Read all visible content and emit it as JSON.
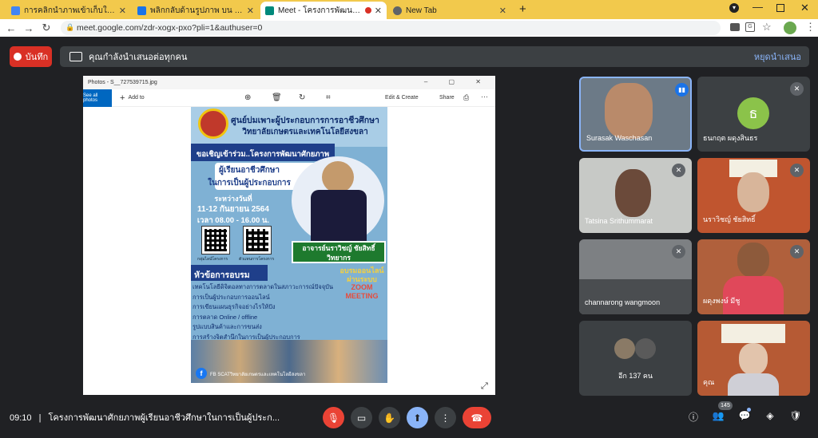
{
  "tabs": [
    {
      "title": "การคลิกนำภาพเข้าเก็บในแกลลอรี่ - ค้นหาโดย",
      "favicon_color": "#4285f4"
    },
    {
      "title": "พลิกกลับด้านรูปภาพ บน PowerPoint",
      "favicon_color": "#1a73e8"
    },
    {
      "title": "Meet - โครงการพัฒนาศักยภาพ",
      "favicon_color": "#00897b"
    },
    {
      "title": "New Tab",
      "favicon_color": "#5f6368"
    }
  ],
  "url": "meet.google.com/zdr-xogx-pxo?pli=1&authuser=0",
  "record_label": "บันทึก",
  "presenting_text": "คุณกำลังนำเสนอต่อทุกคน",
  "stop_presenting": "หยุดนำเสนอ",
  "photos": {
    "window_title": "Photos - S__727539715.jpg",
    "see_all": "See all photos",
    "add_to": "Add to",
    "edit_create": "Edit & Create",
    "share": "Share"
  },
  "poster": {
    "header1": "ศูนย์บ่มเพาะผู้ประกอบการการอาชีวศึกษา",
    "header2": "วิทยาลัยเกษตรและเทคโนโลยีสงขลา",
    "invite1": "ขอเชิญเข้าร่วม..โครงการพัฒนาศักยภาพ",
    "invite2": "ผู้เรียนอาชีวศึกษา",
    "invite3": "ในการเป็นผู้ประกอบการ",
    "date_label": "ระหว่างวันที่",
    "date": "11-12 กันยายน 2564",
    "time": "เวลา 08.00 - 16.00 น.",
    "qr1": "กลุ่มไลน์โครงการ",
    "qr2": "ตัวแทนการโครงการ",
    "speaker": "อาจารย์นราวิชญ์ ชัยสิทธิ์",
    "speaker_role": "วิทยากร",
    "topics_title": "หัวข้อการอบรม",
    "online1": "อบรมออนไลน์",
    "online2": "ผ่านระบบ",
    "online3": "ZOOM",
    "online4": "MEETING",
    "topics": [
      "เทคโนโลยีดิจิตอลทางการตลาดในสภาวะการณ์ปัจจุบัน",
      "การเป็นผู้ประกอบการออนไลน์",
      "การเขียนแผนธุรกิจอย่างไรให้ปัง",
      "การตลาด Online / offline",
      "รูปแบบสินค้าและการขนส่ง",
      "การสร้างจิตสำนึกในการเป็นผู้ประกอบการ"
    ],
    "footer": "FB SCATวิทยาลัยเกษตรและเทคโนโลยีสงขลา"
  },
  "participants": [
    {
      "name": "Surasak Waschasan"
    },
    {
      "name": "ธนกฤต ผดุงสินธร",
      "initial": "ธ"
    },
    {
      "name": "Tatsina Srithummarat"
    },
    {
      "name": "นราวิชญ์ ชัยสิทธิ์"
    },
    {
      "name": "channarong wangmoon"
    },
    {
      "name": "ผดุงพงษ์ มีชู"
    },
    {
      "name": "อีก 137 คน"
    },
    {
      "name": "คุณ"
    }
  ],
  "bottom": {
    "time": "09:10",
    "separator": "|",
    "meeting_title": "โครงการพัฒนาศักยภาพผู้เรียนอาชีวศึกษาในการเป็นผู้ประก...",
    "people_count": "145"
  },
  "colors": {
    "accent": "#8ab4f8",
    "end_call": "#ea4335",
    "mic_off": "#ea4335",
    "tabbar": "#f2c94c"
  }
}
